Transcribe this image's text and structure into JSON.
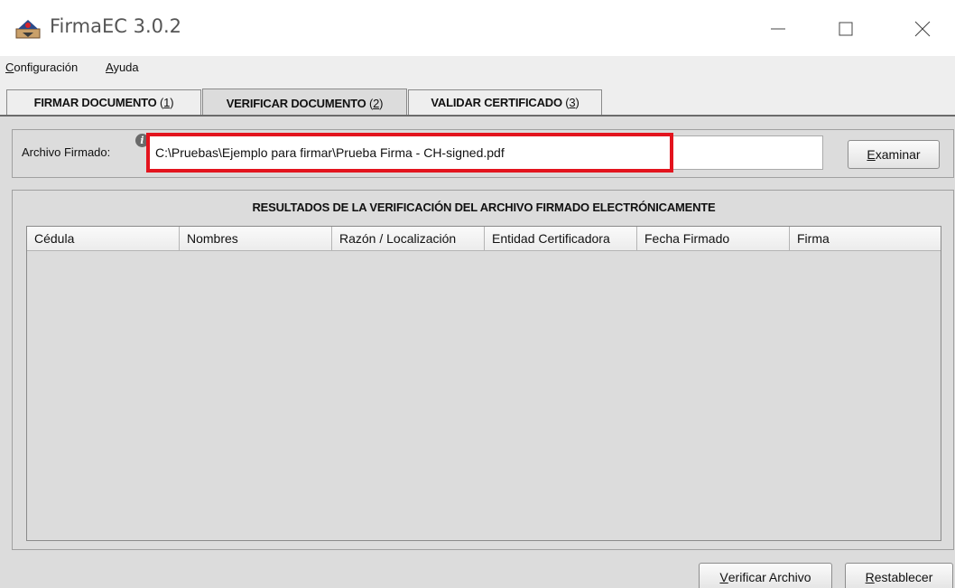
{
  "window": {
    "title": "FirmaEC 3.0.2",
    "icon": "firmaec-logo-icon"
  },
  "menu": {
    "items": [
      {
        "label": "Configuración",
        "hotkey": "C"
      },
      {
        "label": "Ayuda",
        "hotkey": "A"
      }
    ]
  },
  "tabs": [
    {
      "label": "FIRMAR DOCUMENTO",
      "hotkey": "1",
      "active": false
    },
    {
      "label": "VERIFICAR DOCUMENTO",
      "hotkey": "2",
      "active": true
    },
    {
      "label": "VALIDAR CERTIFICADO",
      "hotkey": "3",
      "active": false
    }
  ],
  "file": {
    "label": "Archivo Firmado:",
    "value": "C:\\Pruebas\\Ejemplo para firmar\\Prueba Firma - CH-signed.pdf",
    "browse_button": {
      "label": "Examinar",
      "hotkey": "E"
    }
  },
  "results": {
    "title": "RESULTADOS DE LA VERIFICACIÓN DEL ARCHIVO FIRMADO ELECTRÓNICAMENTE",
    "columns": [
      "Cédula",
      "Nombres",
      "Razón / Localización",
      "Entidad Certificadora",
      "Fecha Firmado",
      "Firma"
    ],
    "rows": []
  },
  "actions": {
    "verify": {
      "label": "Verificar Archivo",
      "hotkey": "V"
    },
    "reset": {
      "label": "Restablecer",
      "hotkey": "R"
    }
  },
  "colors": {
    "highlight": "#e3141e",
    "panel_bg": "#dcdcdc",
    "menubar_bg": "#eeeeee"
  }
}
